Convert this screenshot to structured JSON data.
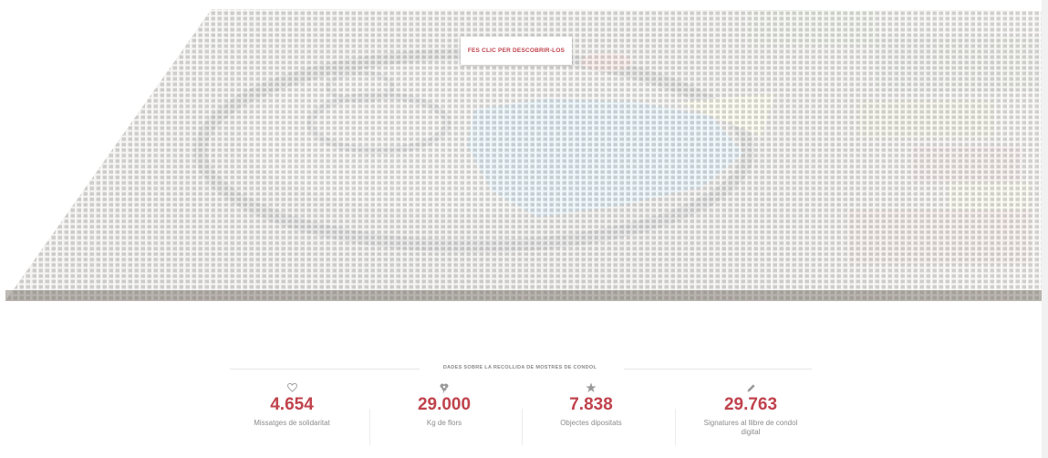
{
  "cta": {
    "label": "FES CLIC PER DESCOBRIR-LOS"
  },
  "colors": {
    "accent": "#c0434d",
    "muted_text": "#8c8c8c",
    "mosaic_blue": "#5ab7e6",
    "mosaic_yellow": "#f0e681",
    "mosaic_ring": "#2a2a2a"
  },
  "stats": {
    "title": "DADES SOBRE LA RECOLLIDA DE MOSTRES DE CONDOL",
    "items": [
      {
        "icon": "heart-icon",
        "value": "4.654",
        "label": "Missatges de solidaritat"
      },
      {
        "icon": "flower-icon",
        "value": "29.000",
        "label": "Kg de flors"
      },
      {
        "icon": "star-icon",
        "value": "7.838",
        "label": "Objectes dipositats"
      },
      {
        "icon": "pencil-icon",
        "value": "29.763",
        "label": "Signatures al llibre de condol digital"
      }
    ]
  }
}
